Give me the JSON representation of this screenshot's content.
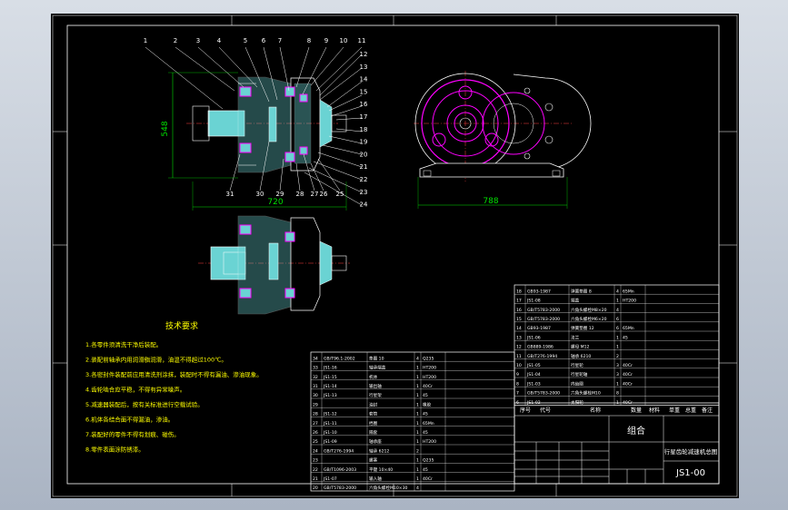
{
  "colors": {
    "background": "#000000",
    "frame": "#ffffff",
    "dimension": "#00e000",
    "notes": "#ffff00",
    "gear": "#ff00ff",
    "part_fill": "#6ad3d3",
    "centerline": "#ff3030",
    "title_text": "#ffffff"
  },
  "dimensions": {
    "height": "548",
    "shaft_length": "720",
    "base_width": "788"
  },
  "balloons_top": [
    "1",
    "2",
    "3",
    "4",
    "5",
    "6",
    "7",
    "8",
    "9",
    "10",
    "11"
  ],
  "balloons_right": [
    "12",
    "13",
    "14",
    "15",
    "16",
    "17",
    "18",
    "19",
    "20",
    "21",
    "22",
    "23",
    "24"
  ],
  "balloons_bottom": [
    "31",
    "30",
    "29",
    "28",
    "27",
    "26",
    "25"
  ],
  "notes": {
    "title": "技术要求",
    "lines": [
      "1.各零件须清洗干净后装配。",
      "2.装配前轴承内用润滑脂润滑，油温不得超过100℃。",
      "3.各密封件装配前应用清洗剂涂抹，装配时不得有漏油、渗油现象。",
      "4.齿轮啮合应平稳，不得有异常噪声。",
      "5.减速器装配后，按有关标准进行空载试验。",
      "6.机体各结合面不得漏油，渗油。",
      "7.装配好的零件不得有划痕、碰伤。",
      "8.零件表面涂防锈漆。"
    ]
  },
  "title_block": {
    "group_label": "组合",
    "drawing_name": "行星齿轮减速机总图",
    "drawing_number": "JS1-00",
    "header": [
      "序号",
      "代号",
      "名称",
      "数量",
      "材料",
      "单重",
      "总重",
      "备注"
    ]
  },
  "bom_upper": [
    {
      "no": "18",
      "code": "GB93-1987",
      "name": "弹簧垫圈 8",
      "qty": "4",
      "mat": "65Mn"
    },
    {
      "no": "17",
      "code": "JS1-08",
      "name": "端盖",
      "qty": "1",
      "mat": "HT200"
    },
    {
      "no": "16",
      "code": "GB/T5783-2000",
      "name": "六角头螺栓M8×20",
      "qty": "4",
      "mat": ""
    },
    {
      "no": "15",
      "code": "GB/T5783-2000",
      "name": "六角头螺栓M6×20",
      "qty": "6",
      "mat": ""
    },
    {
      "no": "14",
      "code": "GB93-1987",
      "name": "弹簧垫圈 12",
      "qty": "6",
      "mat": "65Mn"
    },
    {
      "no": "13",
      "code": "JS1-06",
      "name": "法兰",
      "qty": "1",
      "mat": "45"
    },
    {
      "no": "12",
      "code": "GB889-1986",
      "name": "螺母 M12",
      "qty": "1",
      "mat": ""
    },
    {
      "no": "11",
      "code": "GB/T276-1994",
      "name": "轴承 6210",
      "qty": "2",
      "mat": ""
    },
    {
      "no": "10",
      "code": "JS1-05",
      "name": "行星轮",
      "qty": "3",
      "mat": "40Cr"
    },
    {
      "no": "9",
      "code": "JS1-04",
      "name": "行星轮轴",
      "qty": "3",
      "mat": "40Cr"
    },
    {
      "no": "8",
      "code": "JS1-03",
      "name": "内齿圈",
      "qty": "1",
      "mat": "40Cr"
    },
    {
      "no": "7",
      "code": "GB/T5783-2000",
      "name": "六角头螺栓M10",
      "qty": "8",
      "mat": ""
    },
    {
      "no": "6",
      "code": "JS1-02",
      "name": "太阳轮",
      "qty": "1",
      "mat": "40Cr"
    }
  ],
  "bom_lower": [
    {
      "no": "34",
      "code": "GB/T96.1-2002",
      "name": "垫圈 10",
      "qty": "4",
      "mat": "Q235"
    },
    {
      "no": "33",
      "code": "JS1-16",
      "name": "轴承端盖",
      "qty": "1",
      "mat": "HT200"
    },
    {
      "no": "32",
      "code": "JS1-15",
      "name": "机体",
      "qty": "1",
      "mat": "HT200"
    },
    {
      "no": "31",
      "code": "JS1-14",
      "name": "输出轴",
      "qty": "1",
      "mat": "40Cr"
    },
    {
      "no": "30",
      "code": "JS1-13",
      "name": "行星架",
      "qty": "1",
      "mat": "45"
    },
    {
      "no": "29",
      "code": "",
      "name": "油封",
      "qty": "1",
      "mat": "橡胶"
    },
    {
      "no": "28",
      "code": "JS1-12",
      "name": "套筒",
      "qty": "1",
      "mat": "45"
    },
    {
      "no": "27",
      "code": "JS1-11",
      "name": "挡圈",
      "qty": "1",
      "mat": "65Mn"
    },
    {
      "no": "26",
      "code": "JS1-10",
      "name": "隔套",
      "qty": "1",
      "mat": "45"
    },
    {
      "no": "25",
      "code": "JS1-09",
      "name": "轴承座",
      "qty": "1",
      "mat": "HT200"
    },
    {
      "no": "24",
      "code": "GB/T276-1994",
      "name": "轴承 6212",
      "qty": "2",
      "mat": ""
    },
    {
      "no": "23",
      "code": "",
      "name": "螺塞",
      "qty": "1",
      "mat": "Q235"
    },
    {
      "no": "22",
      "code": "GB/T1096-2003",
      "name": "平键 10×40",
      "qty": "1",
      "mat": "45"
    },
    {
      "no": "21",
      "code": "JS1-07",
      "name": "输入轴",
      "qty": "1",
      "mat": "40Cr"
    },
    {
      "no": "20",
      "code": "GB/T5783-2000",
      "name": "六角头螺栓M10×30",
      "qty": "4",
      "mat": ""
    }
  ]
}
